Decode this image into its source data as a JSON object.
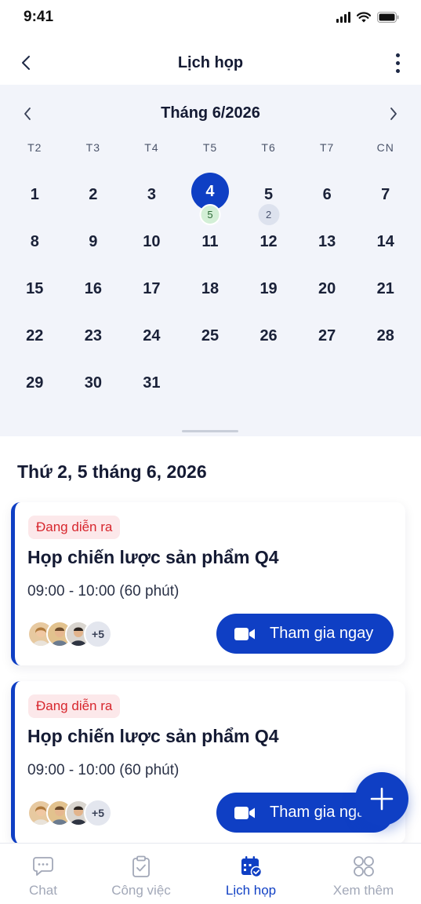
{
  "status_bar": {
    "time": "9:41"
  },
  "header": {
    "title": "Lịch họp"
  },
  "calendar": {
    "month_label": "Tháng 6/2026",
    "weekdays": [
      "T2",
      "T3",
      "T4",
      "T5",
      "T6",
      "T7",
      "CN"
    ],
    "selected_day": "4",
    "days": [
      {
        "d": "1"
      },
      {
        "d": "2"
      },
      {
        "d": "3"
      },
      {
        "d": "4",
        "selected": true,
        "badge": "5",
        "badge_style": "green"
      },
      {
        "d": "5",
        "badge": "2",
        "badge_style": "gray"
      },
      {
        "d": "6"
      },
      {
        "d": "7"
      },
      {
        "d": "8"
      },
      {
        "d": "9"
      },
      {
        "d": "10"
      },
      {
        "d": "11"
      },
      {
        "d": "12"
      },
      {
        "d": "13"
      },
      {
        "d": "14"
      },
      {
        "d": "15"
      },
      {
        "d": "16"
      },
      {
        "d": "17"
      },
      {
        "d": "18"
      },
      {
        "d": "19"
      },
      {
        "d": "20"
      },
      {
        "d": "21"
      },
      {
        "d": "22"
      },
      {
        "d": "23"
      },
      {
        "d": "24"
      },
      {
        "d": "25"
      },
      {
        "d": "26"
      },
      {
        "d": "27"
      },
      {
        "d": "28"
      },
      {
        "d": "29"
      },
      {
        "d": "30"
      },
      {
        "d": "31"
      }
    ]
  },
  "schedule": {
    "date_heading": "Thứ 2, 5 tháng 6, 2026",
    "meetings": [
      {
        "status": "Đang diễn ra",
        "title": "Họp chiến lược sản phẩm Q4",
        "time": "09:00 - 10:00 (60 phút)",
        "extra_participants": "+5",
        "join_label": "Tham gia ngay"
      },
      {
        "status": "Đang diễn ra",
        "title": "Họp chiến lược sản phẩm Q4",
        "time": "09:00 - 10:00 (60 phút)",
        "extra_participants": "+5",
        "join_label": "Tham gia ngay"
      }
    ]
  },
  "bottom_nav": {
    "items": [
      {
        "label": "Chat",
        "icon": "chat-icon"
      },
      {
        "label": "Công việc",
        "icon": "clipboard-check-icon"
      },
      {
        "label": "Lịch họp",
        "icon": "calendar-check-icon",
        "active": true
      },
      {
        "label": "Xem thêm",
        "icon": "grid-more-icon"
      }
    ]
  },
  "colors": {
    "primary": "#0f3fc4",
    "calendar_bg": "#f2f4fa",
    "status_live_text": "#d7262d",
    "status_live_bg": "#fce8ea",
    "nav_inactive": "#a2a8b8"
  }
}
